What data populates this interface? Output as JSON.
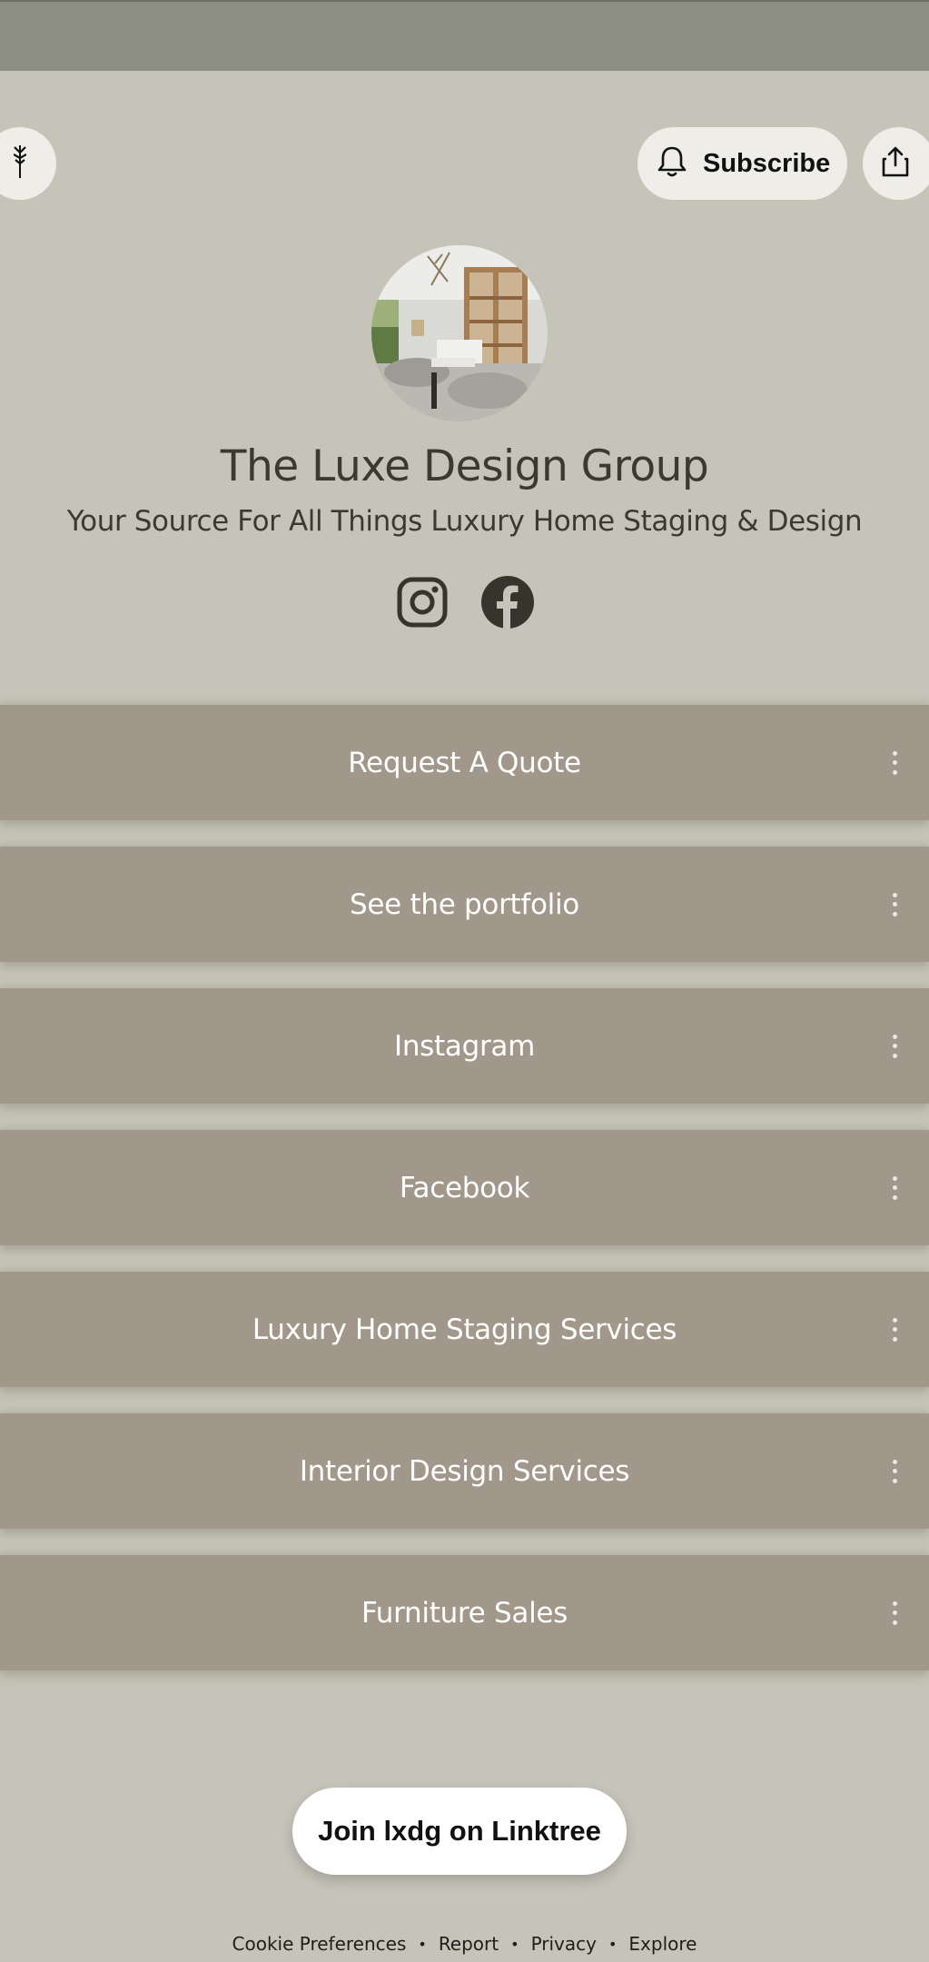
{
  "header": {
    "subscribe_label": "Subscribe",
    "logo_icon": "linktree-icon",
    "bell_icon": "bell-icon",
    "share_icon": "share-icon"
  },
  "profile": {
    "name": "The Luxe Design Group",
    "bio": "Your Source For All Things Luxury Home Staging & Design",
    "socials": [
      {
        "name": "instagram-icon"
      },
      {
        "name": "facebook-icon"
      }
    ]
  },
  "links": [
    {
      "label": "Request A Quote"
    },
    {
      "label": "See the portfolio"
    },
    {
      "label": "Instagram"
    },
    {
      "label": "Facebook"
    },
    {
      "label": "Luxury Home Staging Services"
    },
    {
      "label": "Interior Design Services"
    },
    {
      "label": "Furniture Sales"
    }
  ],
  "join_button": {
    "label": "Join lxdg on Linktree"
  },
  "footer": {
    "items": [
      "Cookie Preferences",
      "Report",
      "Privacy",
      "Explore"
    ]
  },
  "colors": {
    "background": "#c6c4b8",
    "top_bar": "#8d8e84",
    "link_card": "#a2978b",
    "text_dark": "#3b3a32"
  }
}
